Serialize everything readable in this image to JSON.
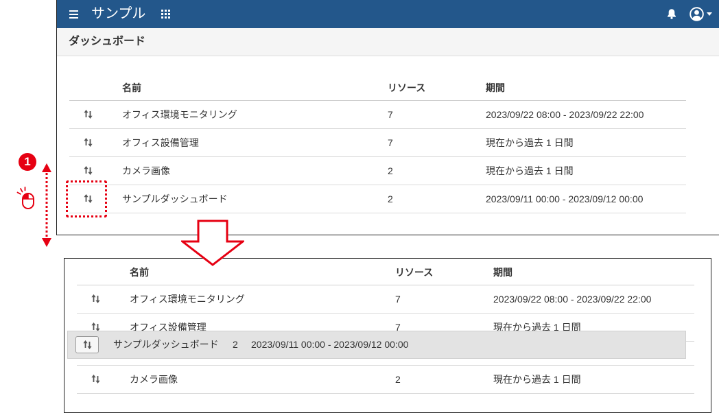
{
  "top_panel": {
    "header": {
      "menu_icon": "hamburger-icon",
      "title": "サンプル",
      "apps_icon": "grid-icon",
      "notifications_icon": "bell-icon",
      "account_icon": "user-circle-icon",
      "account_menu_icon": "caret-down-icon"
    },
    "page_title": "ダッシュボード",
    "table": {
      "columns": {
        "name": "名前",
        "resources": "リソース",
        "period": "期間"
      },
      "row_icon": "sort-arrows-icon",
      "rows": [
        {
          "name": "オフィス環境モニタリング",
          "resources": "7",
          "period": "2023/09/22 08:00 - 2023/09/22 22:00"
        },
        {
          "name": "オフィス設備管理",
          "resources": "7",
          "period": "現在から過去 1 日間"
        },
        {
          "name": "カメラ画像",
          "resources": "2",
          "period": "現在から過去 1 日間"
        },
        {
          "name": "サンプルダッシュボード",
          "resources": "2",
          "period": "2023/09/11 00:00 - 2023/09/12 00:00"
        }
      ]
    }
  },
  "annotation": {
    "step_number": "1",
    "step_icon": "mouse-click-icon",
    "drag_icon": "vertical-double-arrow-icon",
    "transition_icon": "down-arrow-icon"
  },
  "bottom_panel": {
    "table": {
      "columns": {
        "name": "名前",
        "resources": "リソース",
        "period": "期間"
      },
      "rows": [
        {
          "name": "オフィス環境モニタリング",
          "resources": "7",
          "period": "2023/09/22 08:00 - 2023/09/22 22:00"
        },
        {
          "name": "オフィス設備管理",
          "resources": "7",
          "period": "現在から過去 1 日間"
        },
        {
          "name": "カメラ画像",
          "resources": "2",
          "period": "現在から過去 1 日間"
        }
      ],
      "dragging_row": {
        "name": "サンプルダッシュボード",
        "resources": "2",
        "period": "2023/09/11 00:00 - 2023/09/12 00:00"
      }
    }
  },
  "colors": {
    "header_bg": "#23578b",
    "subheader_bg": "#f5f5f5",
    "annotation_red": "#e60012",
    "drag_row_bg": "#e3e3e3",
    "row_line": "#d9d9d9",
    "text": "#333333"
  }
}
